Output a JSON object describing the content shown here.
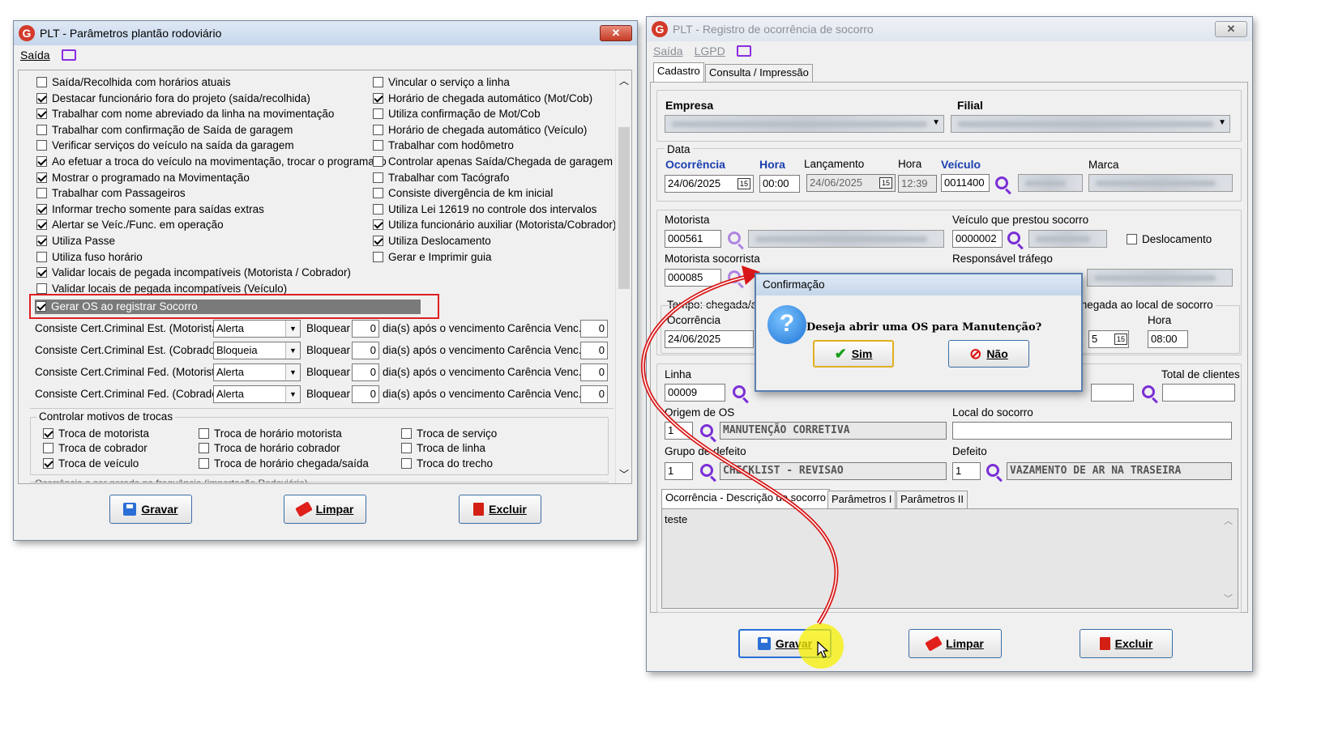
{
  "left_window": {
    "title": "PLT - Parâmetros plantão rodoviário",
    "menu_saida": "Saída",
    "options_left": [
      {
        "label": "Saída/Recolhida com horários atuais",
        "checked": false
      },
      {
        "label": "Destacar funcionário fora do projeto (saída/recolhida)",
        "checked": true
      },
      {
        "label": "Trabalhar com nome abreviado da linha na movimentação",
        "checked": true
      },
      {
        "label": "Trabalhar com confirmação de Saída de garagem",
        "checked": false
      },
      {
        "label": "Verificar serviços do veículo na saída da garagem",
        "checked": false
      },
      {
        "label": "Ao efetuar a troca do veículo na movimentação, trocar o programado",
        "checked": true
      },
      {
        "label": "Mostrar o programado na Movimentação",
        "checked": true
      },
      {
        "label": "Trabalhar com Passageiros",
        "checked": false
      },
      {
        "label": "Informar trecho somente para saídas extras",
        "checked": true
      },
      {
        "label": "Alertar se Veíc./Func. em operação",
        "checked": true
      },
      {
        "label": "Utiliza Passe",
        "checked": true
      },
      {
        "label": "Utiliza fuso horário",
        "checked": false
      },
      {
        "label": "Validar locais de pegada incompatíveis (Motorista / Cobrador)",
        "checked": true
      },
      {
        "label": "Validar locais de pegada incompatíveis (Veículo)",
        "checked": false
      }
    ],
    "options_right": [
      {
        "label": "Vincular o serviço a linha",
        "checked": false
      },
      {
        "label": "Horário de chegada automático (Mot/Cob)",
        "checked": true
      },
      {
        "label": "Utiliza confirmação de Mot/Cob",
        "checked": false
      },
      {
        "label": "Horário de chegada automático (Veículo)",
        "checked": false
      },
      {
        "label": "Trabalhar com hodômetro",
        "checked": false
      },
      {
        "label": "Controlar apenas Saída/Chegada de garagem",
        "checked": false
      },
      {
        "label": "Trabalhar com Tacógrafo",
        "checked": false
      },
      {
        "label": "Consiste divergência de km inicial",
        "checked": false
      },
      {
        "label": "Utiliza Lei 12619 no controle dos intervalos",
        "checked": false
      },
      {
        "label": "Utiliza funcionário auxiliar (Motorista/Cobrador)",
        "checked": true
      },
      {
        "label": "Utiliza Deslocamento",
        "checked": true
      },
      {
        "label": "Gerar e Imprimir guia",
        "checked": false
      }
    ],
    "highlight_option": {
      "label": "Gerar OS ao registrar Socorro",
      "checked": true
    },
    "cert_rows": [
      {
        "label": "Consiste Cert.Criminal Est. (Motorista)",
        "mode": "Alerta",
        "days": "0",
        "carencia": "0"
      },
      {
        "label": "Consiste Cert.Criminal Est. (Cobrador)",
        "mode": "Bloqueia",
        "days": "0",
        "carencia": "0"
      },
      {
        "label": "Consiste Cert.Criminal Fed. (Motorista)",
        "mode": "Alerta",
        "days": "0",
        "carencia": "0"
      },
      {
        "label": "Consiste Cert.Criminal Fed. (Cobrador)",
        "mode": "Alerta",
        "days": "0",
        "carencia": "0"
      }
    ],
    "bloquear_label": "Bloquear",
    "dias_label": "dia(s) após o vencimento",
    "carencia_label": "Carência Venc.",
    "trocas_title": "Controlar motivos de trocas",
    "trocas": [
      {
        "label": "Troca de motorista",
        "checked": true
      },
      {
        "label": "Troca de cobrador",
        "checked": false
      },
      {
        "label": "Troca de veículo",
        "checked": true
      },
      {
        "label": "Troca de horário motorista",
        "checked": false
      },
      {
        "label": "Troca de horário cobrador",
        "checked": false
      },
      {
        "label": "Troca de horário chegada/saída",
        "checked": false
      },
      {
        "label": "Troca de serviço",
        "checked": false
      },
      {
        "label": "Troca de linha",
        "checked": false
      },
      {
        "label": "Troca do trecho",
        "checked": false
      }
    ],
    "cut_text": "Ocorrência a ser gerada na frequência (importação Rodoviário)",
    "buttons": {
      "gravar": "Gravar",
      "limpar": "Limpar",
      "excluir": "Excluir"
    }
  },
  "right_window": {
    "title": "PLT - Registro de ocorrência de socorro",
    "menu_saida": "Saída",
    "menu_lgpd": "LGPD",
    "tabs": [
      "Cadastro",
      "Consulta / Impressão"
    ],
    "empresa_label": "Empresa",
    "filial_label": "Filial",
    "data_group": "Data",
    "ocorrencia_label": "Ocorrência",
    "ocorrencia_value": "24/06/2025",
    "hora_label": "Hora",
    "hora_value": "00:00",
    "lancamento_label": "Lançamento",
    "lancamento_value": "24/06/2025",
    "hora2_label": "Hora",
    "hora2_value": "12:39",
    "veiculo_label": "Veículo",
    "veiculo_value": "0011400",
    "marca_label": "Marca",
    "motorista_label": "Motorista",
    "motorista_value": "000561",
    "veiculo_socorro_label": "Veículo que prestou socorro",
    "veiculo_socorro_value": "0000002",
    "deslocamento_label": "Deslocamento",
    "motorista_socorrista_label": "Motorista socorrista",
    "motorista_socorrista_value": "000085",
    "responsavel_label": "Responsável tráfego",
    "tempo_label": "Tempo: chegada/atendimento no",
    "ocorrencia2_label": "Ocorrência",
    "ocorrencia2_value": "24/06/2025",
    "chegada_label": "Chegada ao local de socorro",
    "hora3_label": "Hora",
    "hora3_value": "08:00",
    "date3_partial": "5",
    "linha_label": "Linha",
    "linha_value": "00009",
    "total_clientes_label": "Total de clientes",
    "origem_label": "Origem de OS",
    "origem_code": "1",
    "origem_desc": "MANUTENÇÃO CORRETIVA",
    "local_label": "Local do socorro",
    "grupo_label": "Grupo de defeito",
    "grupo_code": "1",
    "grupo_desc": "CHECKLIST - REVISAO",
    "defeito_label": "Defeito",
    "defeito_code": "1",
    "defeito_desc": "VAZAMENTO DE AR NA TRASEIRA",
    "subtabs": [
      "Ocorrência - Descrição do socorro",
      "Parâmetros I",
      "Parâmetros II"
    ],
    "memo": "teste",
    "buttons": {
      "gravar": "Gravar",
      "limpar": "Limpar",
      "excluir": "Excluir"
    }
  },
  "dialog": {
    "title": "Confirmação",
    "message": "Deseja abrir uma OS para Manutenção?",
    "yes": "Sim",
    "no": "Não"
  },
  "colors": {
    "highlight_red": "#e02020",
    "accent_purple": "#7b2fd6",
    "label_blue": "#1a3fb0",
    "cursor_yellow": "#f5f000"
  }
}
